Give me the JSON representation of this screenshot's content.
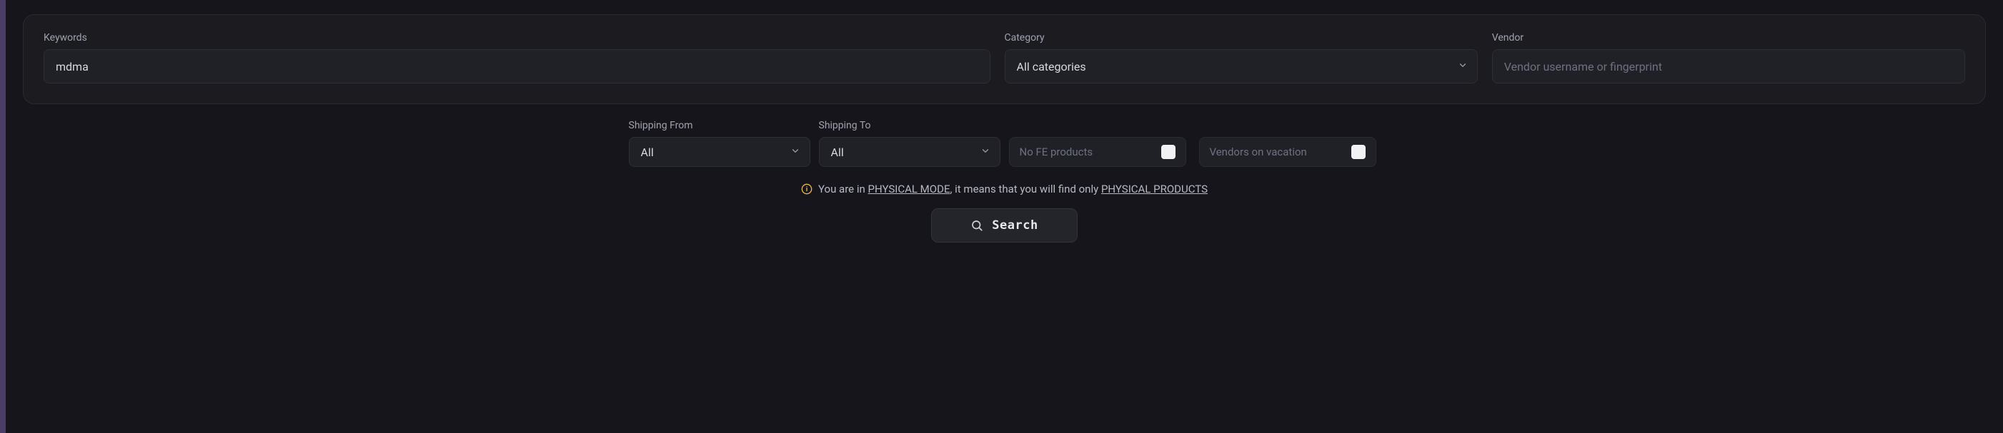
{
  "panel": {
    "keywords_label": "Keywords",
    "keywords_value": "mdma",
    "category_label": "Category",
    "category_selected": "All categories",
    "vendor_label": "Vendor",
    "vendor_placeholder": "Vendor username or fingerprint"
  },
  "row2": {
    "shipping_from_label": "Shipping From",
    "shipping_from_selected": "All",
    "shipping_to_label": "Shipping To",
    "shipping_to_selected": "All",
    "no_fe_label": "No FE products",
    "vacation_label": "Vendors on vacation"
  },
  "notice": {
    "pre": "You are in ",
    "mode": "PHYSICAL MODE",
    "mid": ", it means that you will find only ",
    "products": "PHYSICAL PRODUCTS"
  },
  "search_button_label": "Search"
}
